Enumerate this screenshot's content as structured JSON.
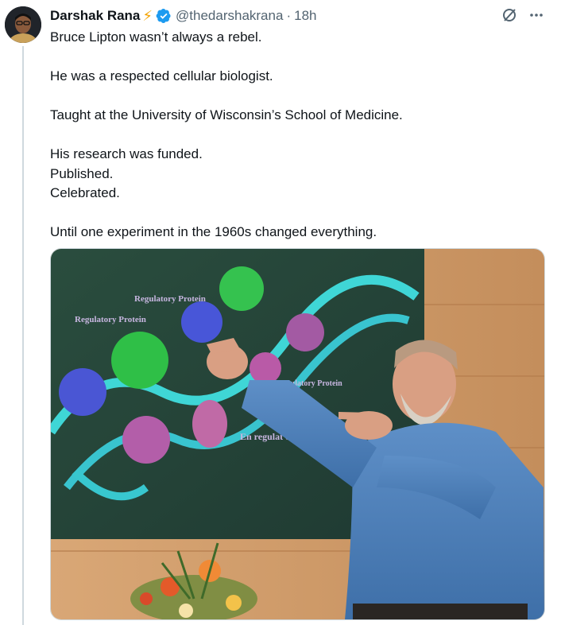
{
  "author": {
    "name": "Darshak Rana",
    "badge_emoji": "⚡",
    "handle": "@thedarshakrana",
    "separator": "·",
    "time": "18h"
  },
  "actions": {
    "grok_icon": "slash-circle-icon",
    "more_icon": "more-dots-icon",
    "more_label": "···"
  },
  "tweet": {
    "lines": [
      "Bruce Lipton wasn’t always a rebel.",
      "",
      "He was a respected cellular biologist.",
      "",
      "Taught at the University of Wisconsin’s School of Medicine.",
      "",
      "His research was funded.",
      "Published.",
      "Celebrated.",
      "",
      "Until one experiment in the 1960s changed everything."
    ]
  },
  "media": {
    "slide_labels": [
      "Regulatory Protein",
      "Regulatory Protein",
      "Regulatory Protein",
      "En regulat causing"
    ]
  },
  "colors": {
    "verified": "#1d9bf0",
    "muted": "#536471",
    "text": "#0f1419",
    "thread_line": "#cfd9de"
  }
}
